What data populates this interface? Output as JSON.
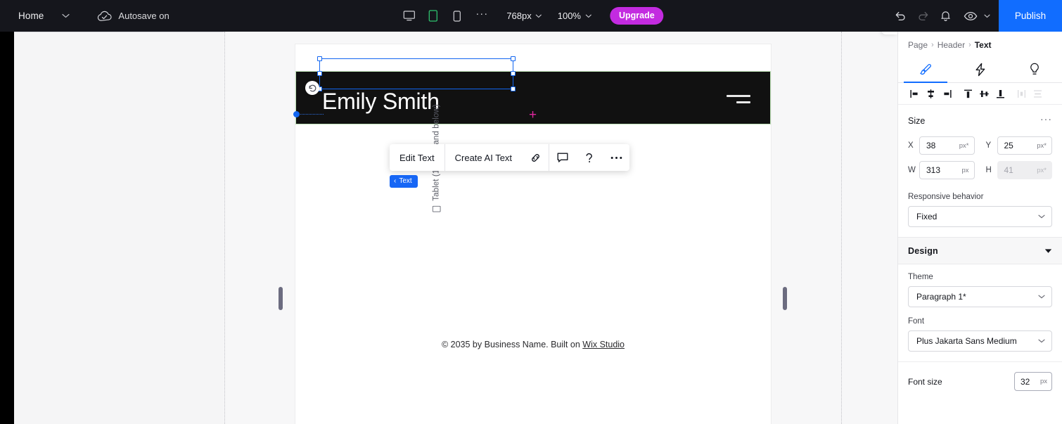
{
  "topbar": {
    "home_label": "Home",
    "home_caret_icon": "chevron-down-icon",
    "autosave_icon": "cloud-check-icon",
    "autosave_label": "Autosave on",
    "devices": [
      {
        "name": "desktop",
        "icon": "monitor-icon",
        "active": false
      },
      {
        "name": "tablet",
        "icon": "tablet-icon",
        "active": true
      },
      {
        "name": "mobile",
        "icon": "phone-icon",
        "active": false
      }
    ],
    "more_icon": "ellipsis-icon",
    "breakpoint_value": "768px",
    "zoom_value": "100%",
    "upgrade_label": "Upgrade",
    "undo_icon": "undo-icon",
    "redo_icon": "redo-icon",
    "bell_icon": "bell-icon",
    "preview_icon": "eye-icon",
    "publish_label": "Publish"
  },
  "stage": {
    "breakpoint_label": "Tablet (1000px and below)",
    "breakpoint_icon": "tablet-icon"
  },
  "canvas": {
    "headline": "Emily Smith",
    "menu_icon": "hamburger-icon",
    "footer_text": "© 2035 by Business Name. Built on ",
    "footer_link": "Wix Studio",
    "plus_mark": "+",
    "rotate_icon": "reset-rotation-icon"
  },
  "float_toolbar": {
    "edit_text_label": "Edit Text",
    "create_ai_text_label": "Create AI Text",
    "link_icon": "link-icon",
    "comment_icon": "comment-icon",
    "help_icon": "question-mark-icon",
    "more_icon": "ellipsis-icon"
  },
  "text_badge": {
    "chevron": "‹",
    "label": "Text"
  },
  "panel": {
    "collapse_icon": "chevron-right-icon",
    "breadcrumb": [
      {
        "label": "Page",
        "current": false
      },
      {
        "label": "Header",
        "current": false
      },
      {
        "label": "Text",
        "current": true
      }
    ],
    "breadcrumb_separator": "›",
    "tabs": [
      {
        "name": "design",
        "icon": "brush-icon",
        "active": true
      },
      {
        "name": "interactions",
        "icon": "lightning-icon",
        "active": false
      },
      {
        "name": "ideas",
        "icon": "lightbulb-icon",
        "active": false
      }
    ],
    "align_buttons": [
      {
        "name": "align-left",
        "icon": "align-left-icon",
        "disabled": false
      },
      {
        "name": "align-center-horizontal",
        "icon": "align-center-h-icon",
        "disabled": false
      },
      {
        "name": "align-right",
        "icon": "align-right-icon",
        "disabled": false
      },
      {
        "name": "align-top",
        "icon": "align-top-icon",
        "disabled": false
      },
      {
        "name": "align-middle-vertical",
        "icon": "align-middle-v-icon",
        "disabled": false
      },
      {
        "name": "align-bottom",
        "icon": "align-bottom-icon",
        "disabled": false
      },
      {
        "name": "distribute-horizontal",
        "icon": "distribute-h-icon",
        "disabled": true
      },
      {
        "name": "distribute-vertical",
        "icon": "distribute-v-icon",
        "disabled": true
      }
    ],
    "size": {
      "title": "Size",
      "more_icon": "ellipsis-icon",
      "x_label": "X",
      "x_value": "38",
      "x_unit": "px*",
      "y_label": "Y",
      "y_value": "25",
      "y_unit": "px*",
      "w_label": "W",
      "w_value": "313",
      "w_unit": "px",
      "h_label": "H",
      "h_value": "41",
      "h_unit": "px*"
    },
    "responsive": {
      "label": "Responsive behavior",
      "value": "Fixed",
      "chevron_icon": "chevron-down-icon"
    },
    "design": {
      "title": "Design",
      "collapse_icon": "triangle-down-icon",
      "theme_label": "Theme",
      "theme_value": "Paragraph 1*",
      "font_label": "Font",
      "font_value": "Plus Jakarta Sans Medium",
      "font_size_label": "Font size",
      "font_size_value": "32",
      "font_size_unit": "px"
    }
  },
  "colors": {
    "topbar_bg": "#15161c",
    "publish_blue": "#116dff",
    "upgrade_purple": "#c32be0",
    "selection_blue": "#1266f1",
    "header_black": "#111111",
    "breakpoint_green": "#bfe3b7",
    "plus_magenta": "#e0279f"
  }
}
